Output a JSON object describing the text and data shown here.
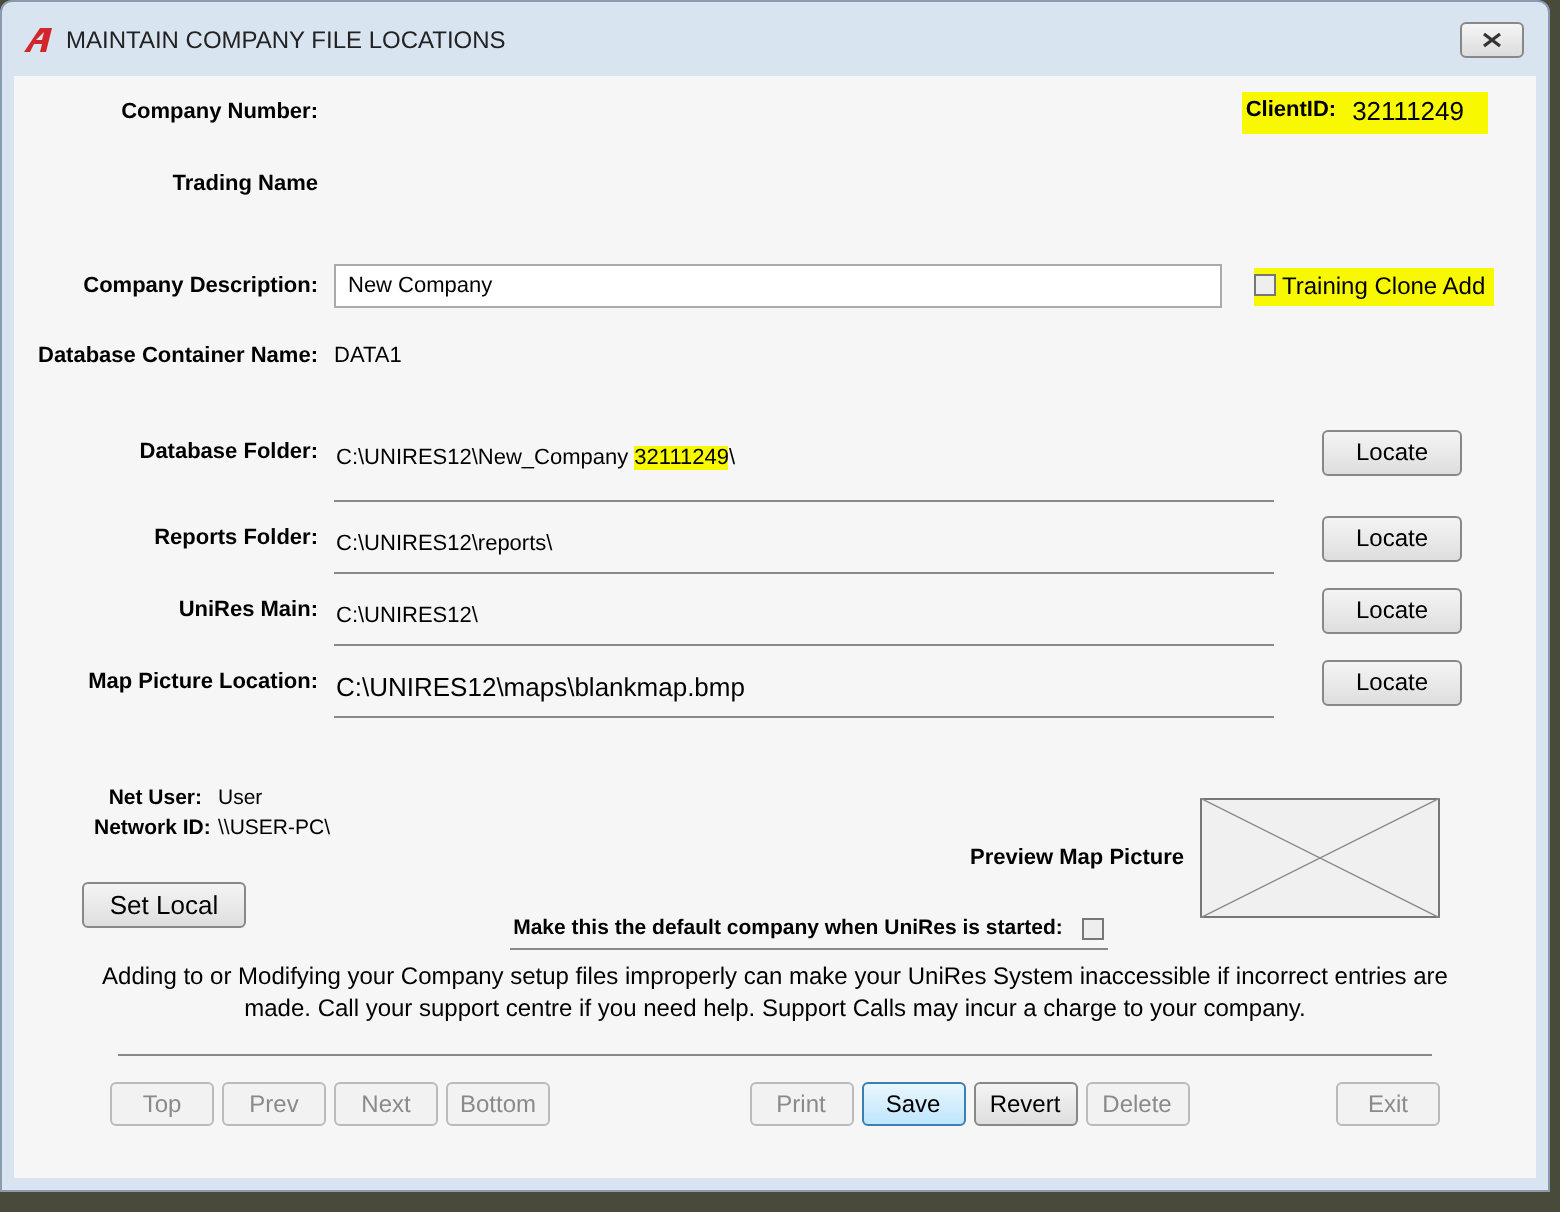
{
  "window": {
    "title": "MAINTAIN COMPANY FILE LOCATIONS"
  },
  "company_number": {
    "label": "Company Number:"
  },
  "client_id": {
    "label": "ClientID:",
    "value": "32111249",
    "highlighted": true
  },
  "trading_name": {
    "label": "Trading Name"
  },
  "company_description": {
    "label": "Company Description:",
    "value": "New Company"
  },
  "training_clone_add": {
    "label": "Training Clone Add",
    "checked": false,
    "highlighted": true
  },
  "database_container": {
    "label": "Database Container Name:",
    "value": "DATA1"
  },
  "locations": [
    {
      "label": "Database Folder:",
      "kind": "small",
      "path": [
        {
          "text": "C:\\UNIRES12\\New_Company ",
          "highlighted": false
        },
        {
          "text": "32111249",
          "highlighted": true
        },
        {
          "text": "\\",
          "highlighted": false
        }
      ],
      "button": "Locate"
    },
    {
      "label": "Reports Folder:",
      "kind": "small",
      "path": [
        {
          "text": "C:\\UNIRES12\\reports\\",
          "highlighted": false
        }
      ],
      "button": "Locate"
    },
    {
      "label": "UniRes Main:",
      "kind": "small",
      "path": [
        {
          "text": "C:\\UNIRES12\\",
          "highlighted": false
        }
      ],
      "button": "Locate"
    },
    {
      "label": "Map Picture Location:",
      "kind": "large",
      "path": [
        {
          "text": "C:\\UNIRES12\\maps\\blankmap.bmp",
          "highlighted": false
        }
      ],
      "button": "Locate"
    }
  ],
  "net_user": {
    "label": "Net User:",
    "value": "User"
  },
  "network_id": {
    "label": "Network ID:",
    "value": "\\\\USER-PC\\"
  },
  "preview_map": {
    "label": "Preview Map Picture"
  },
  "set_local_button": "Set Local",
  "default_company": {
    "label": "Make this the default company when UniRes is started:",
    "checked": false
  },
  "warning": "Adding to or Modifying your Company setup files improperly can make your UniRes System inaccessible if incorrect entries are made. Call your support centre if you need help. Support Calls may incur a charge to your company.",
  "nav_buttons": [
    {
      "label": "Top",
      "disabled": true,
      "focused": false
    },
    {
      "label": "Prev",
      "disabled": true,
      "focused": false
    },
    {
      "label": "Next",
      "disabled": true,
      "focused": false
    },
    {
      "label": "Bottom",
      "disabled": true,
      "focused": false
    }
  ],
  "action_buttons": [
    {
      "label": "Print",
      "disabled": true,
      "focused": false
    },
    {
      "label": "Save",
      "disabled": false,
      "focused": true
    },
    {
      "label": "Revert",
      "disabled": false,
      "focused": false
    },
    {
      "label": "Delete",
      "disabled": true,
      "focused": false
    }
  ],
  "exit_buttons": [
    {
      "label": "Exit",
      "disabled": true,
      "focused": false
    }
  ]
}
